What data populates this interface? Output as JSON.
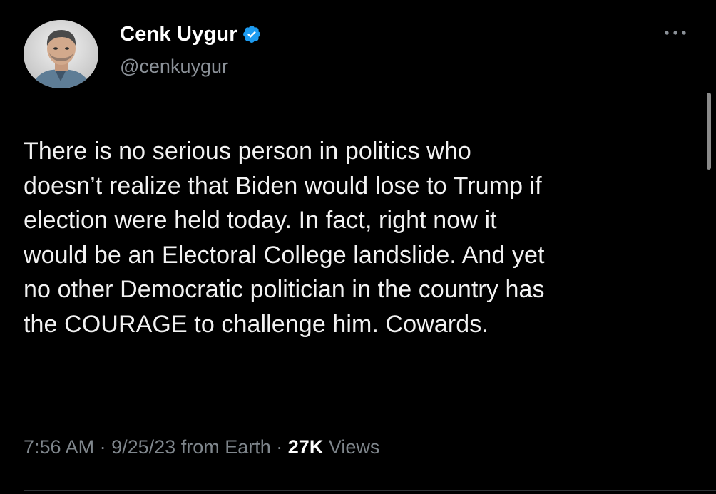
{
  "author": {
    "display_name": "Cenk Uygur",
    "handle": "@cenkuygur",
    "verified": true,
    "verified_color": "#1d9bf0",
    "avatar_icon": "profile-photo"
  },
  "menu": {
    "icon": "more-horizontal-icon"
  },
  "tweet": {
    "text": "There is no serious person in politics who\ndoesn’t realize that Biden would lose to Trump if\nelection were held today. In fact, right now it\nwould be an Electoral College landslide. And yet\nno other Democratic politician in the country has\nthe COURAGE to challenge him. Cowards."
  },
  "meta": {
    "time": "7:56 AM",
    "separator": "·",
    "date": "9/25/23",
    "source": "from Earth",
    "views_count": "27K",
    "views_label": "Views"
  },
  "colors": {
    "background": "#000000",
    "text": "#e7e9ea",
    "secondary": "#8b9198",
    "accent": "#1d9bf0"
  }
}
